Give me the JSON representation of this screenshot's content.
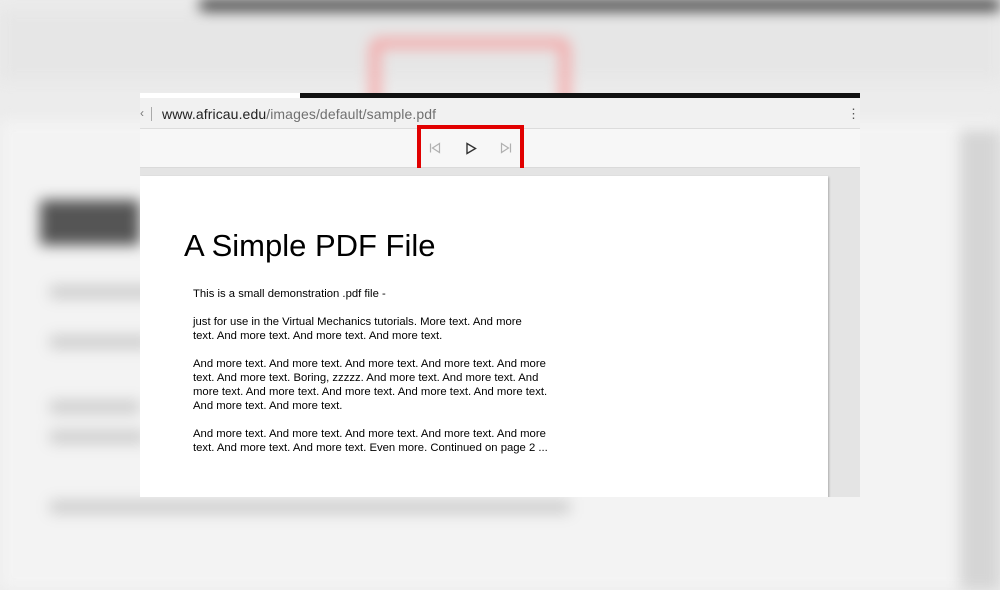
{
  "browser": {
    "url_domain": "www.africau.edu",
    "url_path": "/images/default/sample.pdf",
    "chevron": "‹",
    "menu_glyph": "⋮"
  },
  "toolbar": {
    "prev_icon": "skip-back-icon",
    "play_icon": "play-icon",
    "next_icon": "skip-forward-icon",
    "highlight_color": "#e10000"
  },
  "pdf": {
    "title": "A Simple PDF File",
    "paragraphs": [
      "This is a small demonstration .pdf file -",
      "just for use in the Virtual Mechanics tutorials. More text. And more\ntext. And more text. And more text. And more text.",
      "And more text. And more text. And more text. And more text. And more\ntext. And more text. Boring, zzzzz. And more text. And more text. And\nmore text. And more text. And more text. And more text. And more text.\nAnd more text. And more text.",
      "And more text. And more text. And more text. And more text. And more\ntext. And more text. And more text. Even more. Continued on page 2 ..."
    ]
  }
}
